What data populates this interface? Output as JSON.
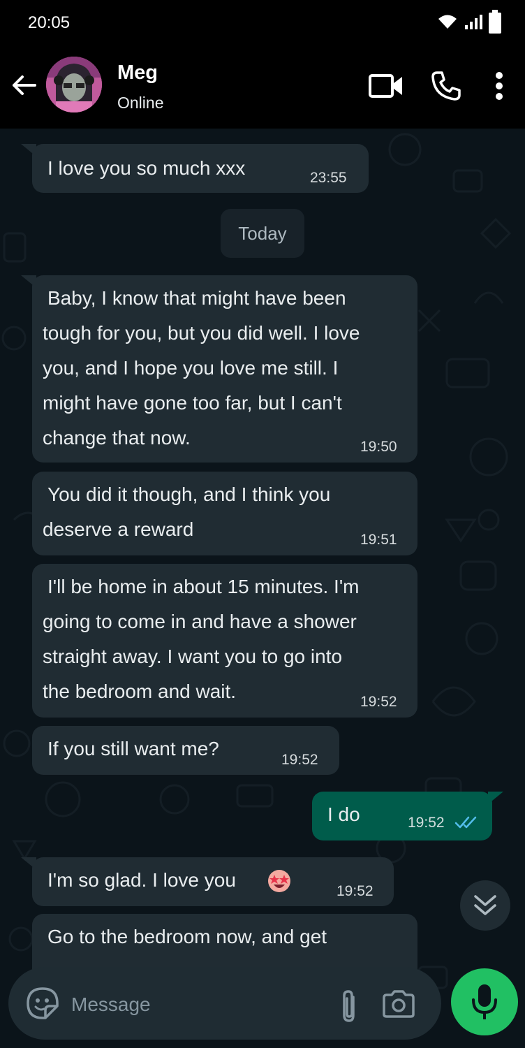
{
  "status_bar": {
    "time": "20:05"
  },
  "contact": {
    "name": "Meg",
    "presence": "Online"
  },
  "header_icons": [
    "back-arrow-icon",
    "video-call-icon",
    "voice-call-icon",
    "more-options-icon"
  ],
  "day_separator": "Today",
  "messages": [
    {
      "direction": "incoming",
      "lines": [
        "I love you so much xxx"
      ],
      "time": "23:55"
    },
    {
      "direction": "incoming",
      "lines": [
        "Baby, I know that might have been",
        "tough for you, but you did well. I love",
        "you, and I hope you love me still. I",
        "might have gone too far, but I can't",
        "change that now."
      ],
      "time": "19:50"
    },
    {
      "direction": "incoming",
      "lines": [
        "You did it though, and I think you",
        "deserve a reward"
      ],
      "time": "19:51"
    },
    {
      "direction": "incoming",
      "lines": [
        "I'll be home in about 15 minutes. I'm",
        "going to come in and have a shower",
        "straight away. I want you to go into",
        "the bedroom and wait."
      ],
      "time": "19:52"
    },
    {
      "direction": "incoming",
      "lines": [
        "If you still want me?"
      ],
      "time": "19:52"
    },
    {
      "direction": "outgoing",
      "lines": [
        "I do"
      ],
      "time": "19:52",
      "status": "read"
    },
    {
      "direction": "incoming",
      "lines": [
        "I'm so glad. I love you"
      ],
      "emoji": "star-struck-emoji",
      "time": "19:52"
    },
    {
      "direction": "incoming",
      "lines": [
        "Go to the bedroom now, and get"
      ],
      "time": ""
    }
  ],
  "composer": {
    "placeholder": "Message"
  },
  "colors": {
    "incoming_bubble": "#202c33",
    "outgoing_bubble": "#005c4b",
    "accent_green": "#21c063",
    "read_ticks": "#53bdeb",
    "background": "#0b141a"
  }
}
